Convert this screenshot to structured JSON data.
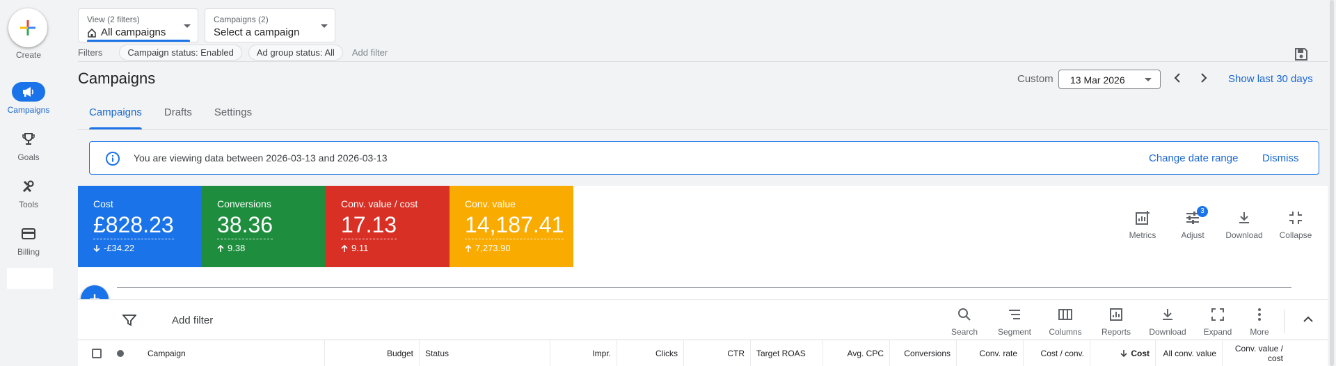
{
  "rail": {
    "create_label": "Create",
    "items": [
      {
        "label": "Campaigns",
        "icon": "megaphone-icon",
        "active": true
      },
      {
        "label": "Goals",
        "icon": "trophy-icon",
        "active": false
      },
      {
        "label": "Tools",
        "icon": "tools-icon",
        "active": false
      },
      {
        "label": "Billing",
        "icon": "credit-card-icon",
        "active": false
      }
    ]
  },
  "view_selector": {
    "small": "View (2 filters)",
    "main": "All campaigns"
  },
  "campaign_selector": {
    "small": "Campaigns (2)",
    "main": "Select a campaign"
  },
  "filters": {
    "label": "Filters",
    "chips": [
      "Campaign status: Enabled",
      "Ad group status: All"
    ],
    "add": "Add filter"
  },
  "page_title": "Campaigns",
  "date": {
    "custom_label": "Custom",
    "value": "13 Mar 2026",
    "show_last": "Show last 30 days"
  },
  "tabs": [
    {
      "label": "Campaigns",
      "active": true
    },
    {
      "label": "Drafts",
      "active": false
    },
    {
      "label": "Settings",
      "active": false
    }
  ],
  "banner": {
    "text": "You are viewing data between 2026-03-13 and 2026-03-13",
    "change": "Change date range",
    "dismiss": "Dismiss"
  },
  "scorecards": [
    {
      "name": "Cost",
      "value": "£828.23",
      "delta": "-£34.22",
      "direction": "down",
      "color": "#1a73e8"
    },
    {
      "name": "Conversions",
      "value": "38.36",
      "delta": "9.38",
      "direction": "up",
      "color": "#1e8e3e"
    },
    {
      "name": "Conv. value / cost",
      "value": "17.13",
      "delta": "9.11",
      "direction": "up",
      "color": "#d93025"
    },
    {
      "name": "Conv. value",
      "value": "14,187.41",
      "delta": "7,273.90",
      "direction": "up",
      "color": "#f9ab00"
    }
  ],
  "card_tools": [
    {
      "label": "Metrics",
      "icon": "metrics-icon"
    },
    {
      "label": "Adjust",
      "icon": "adjust-icon",
      "badge": "3"
    },
    {
      "label": "Download",
      "icon": "download-icon"
    },
    {
      "label": "Collapse",
      "icon": "collapse-icon"
    }
  ],
  "table_toolbar": {
    "add_filter": "Add filter",
    "tools": [
      {
        "label": "Search",
        "icon": "search-icon"
      },
      {
        "label": "Segment",
        "icon": "segment-icon"
      },
      {
        "label": "Columns",
        "icon": "columns-icon"
      },
      {
        "label": "Reports",
        "icon": "reports-icon"
      },
      {
        "label": "Download",
        "icon": "download-icon"
      },
      {
        "label": "Expand",
        "icon": "expand-icon"
      },
      {
        "label": "More",
        "icon": "more-icon"
      }
    ]
  },
  "columns": [
    {
      "label": "Campaign",
      "align": "left",
      "bold": false
    },
    {
      "label": "Budget",
      "align": "right",
      "bold": false
    },
    {
      "label": "Status",
      "align": "left",
      "bold": false
    },
    {
      "label": "Impr.",
      "align": "right",
      "bold": false
    },
    {
      "label": "Clicks",
      "align": "right",
      "bold": false
    },
    {
      "label": "CTR",
      "align": "right",
      "bold": false
    },
    {
      "label": "Target ROAS",
      "align": "left",
      "bold": false
    },
    {
      "label": "Avg. CPC",
      "align": "right",
      "bold": false
    },
    {
      "label": "Conversions",
      "align": "right",
      "bold": false
    },
    {
      "label": "Conv. rate",
      "align": "right",
      "bold": false
    },
    {
      "label": "Cost / conv.",
      "align": "right",
      "bold": false
    },
    {
      "label": "Cost",
      "align": "right",
      "bold": true,
      "sorted": "desc"
    },
    {
      "label": "All conv. value",
      "align": "right",
      "bold": false
    },
    {
      "label": "Conv. value / cost",
      "align": "right",
      "bold": false
    }
  ]
}
